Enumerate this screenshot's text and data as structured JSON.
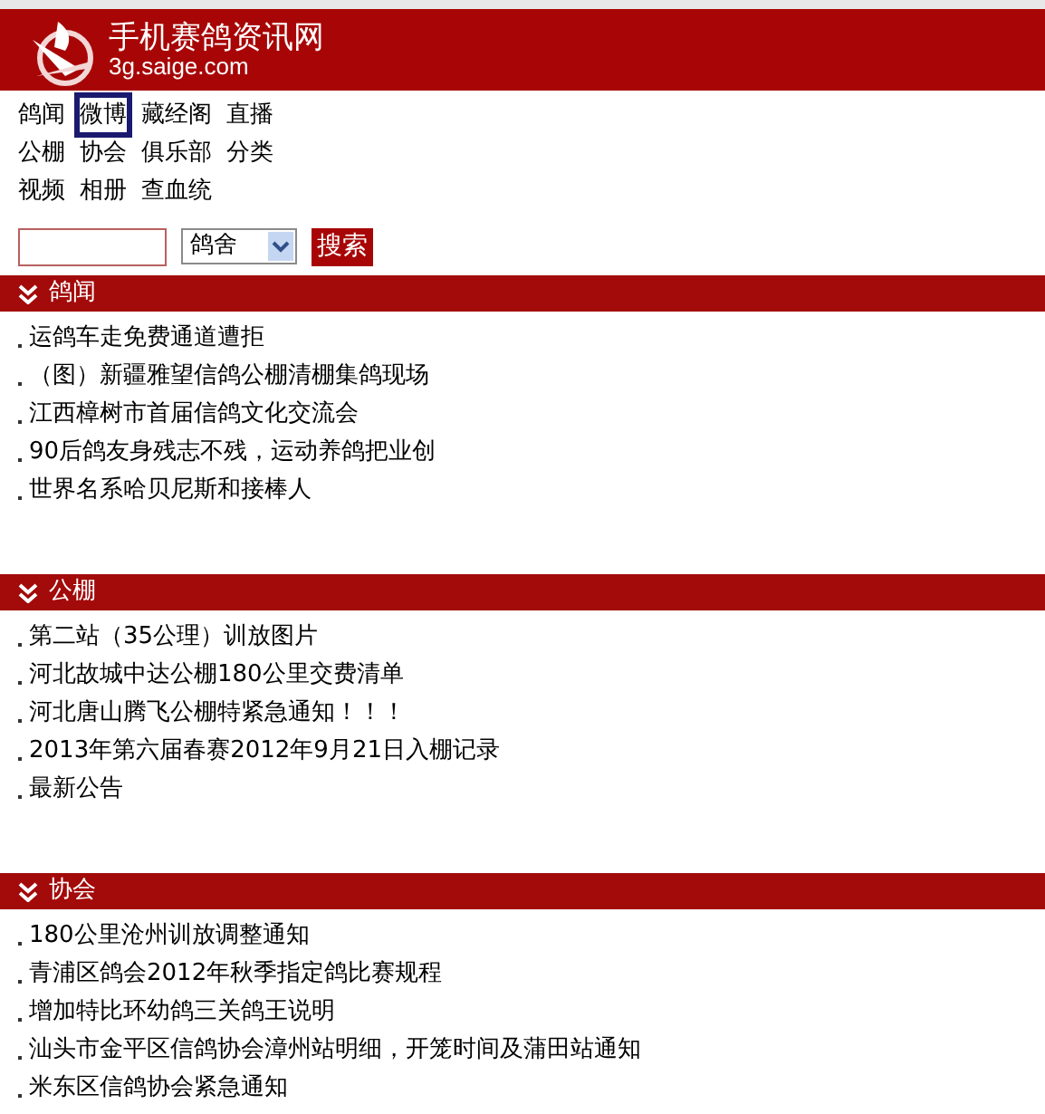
{
  "header": {
    "title": "手机赛鸽资讯网",
    "subtitle": "3g.saige.com"
  },
  "nav": [
    [
      {
        "label": "鸽闻",
        "selected": false
      },
      {
        "label": "微博",
        "selected": true
      },
      {
        "label": "藏经阁",
        "selected": false
      },
      {
        "label": "直播",
        "selected": false
      }
    ],
    [
      {
        "label": "公棚",
        "selected": false
      },
      {
        "label": "协会",
        "selected": false
      },
      {
        "label": "俱乐部",
        "selected": false
      },
      {
        "label": "分类",
        "selected": false
      }
    ],
    [
      {
        "label": "视频",
        "selected": false
      },
      {
        "label": "相册",
        "selected": false
      },
      {
        "label": "查血统",
        "selected": false
      }
    ]
  ],
  "search": {
    "select": "鸽舍",
    "button": "搜索"
  },
  "sections": [
    {
      "title": "鸽闻",
      "items": [
        "运鸽车走免费通道遭拒",
        "（图）新疆雅望信鸽公棚清棚集鸽现场",
        "江西樟树市首届信鸽文化交流会",
        "90后鸽友身残志不残，运动养鸽把业创",
        "世界名系哈贝尼斯和接棒人"
      ]
    },
    {
      "title": "公棚",
      "items": [
        "第二站（35公理）训放图片",
        "河北故城中达公棚180公里交费清单",
        "河北唐山腾飞公棚特紧急通知！！！",
        "2013年第六届春赛2012年9月21日入棚记录",
        "最新公告"
      ]
    },
    {
      "title": "协会",
      "items": [
        "180公里沧州训放调整通知",
        "青浦区鸽会2012年秋季指定鸽比赛规程",
        "增加特比环幼鸽三关鸽王说明",
        "汕头市金平区信鸽协会漳州站明细，开笼时间及蒲田站通知",
        "米东区信鸽协会紧急通知"
      ]
    }
  ]
}
